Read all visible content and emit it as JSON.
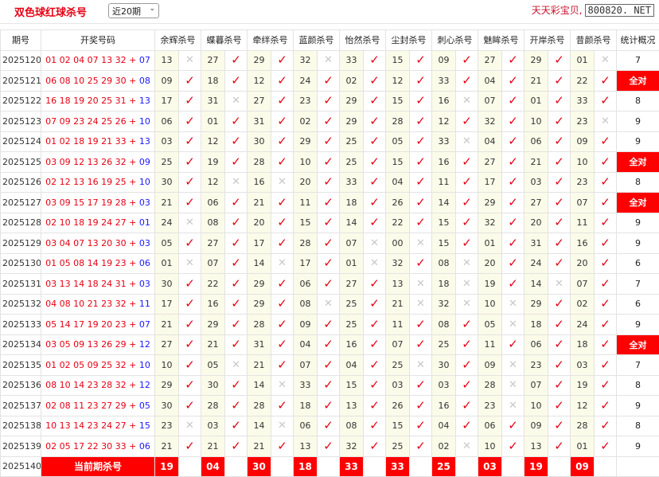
{
  "header": {
    "title": "双色球红球杀号",
    "period_select": "近20期",
    "brand_text": "天天彩宝贝,",
    "site": "800820. NET"
  },
  "columns": {
    "issue": "期号",
    "draw": "开奖号码",
    "experts": [
      "余辉杀号",
      "蝶暮杀号",
      "牵绊杀号",
      "蓝颜杀号",
      "怡然杀号",
      "尘封杀号",
      "刺心杀号",
      "魅眸杀号",
      "开岸杀号",
      "昔颜杀号"
    ],
    "stat": "统计概况"
  },
  "rows": [
    {
      "issue": "2025120",
      "red": "01 02 04 07 13 32",
      "blue": "07",
      "kills": [
        {
          "n": "13",
          "ok": false
        },
        {
          "n": "27",
          "ok": true
        },
        {
          "n": "29",
          "ok": true
        },
        {
          "n": "32",
          "ok": false
        },
        {
          "n": "33",
          "ok": true
        },
        {
          "n": "15",
          "ok": true
        },
        {
          "n": "09",
          "ok": true
        },
        {
          "n": "27",
          "ok": true
        },
        {
          "n": "29",
          "ok": true
        },
        {
          "n": "01",
          "ok": false
        }
      ],
      "stat": "7"
    },
    {
      "issue": "2025121",
      "red": "06 08 10 25 29 30",
      "blue": "08",
      "kills": [
        {
          "n": "09",
          "ok": true
        },
        {
          "n": "18",
          "ok": true
        },
        {
          "n": "12",
          "ok": true
        },
        {
          "n": "24",
          "ok": true
        },
        {
          "n": "02",
          "ok": true
        },
        {
          "n": "12",
          "ok": true
        },
        {
          "n": "33",
          "ok": true
        },
        {
          "n": "04",
          "ok": true
        },
        {
          "n": "21",
          "ok": true
        },
        {
          "n": "22",
          "ok": true
        }
      ],
      "stat": "全对"
    },
    {
      "issue": "2025122",
      "red": "16 18 19 20 25 31",
      "blue": "13",
      "kills": [
        {
          "n": "17",
          "ok": true
        },
        {
          "n": "31",
          "ok": false
        },
        {
          "n": "27",
          "ok": true
        },
        {
          "n": "23",
          "ok": true
        },
        {
          "n": "29",
          "ok": true
        },
        {
          "n": "15",
          "ok": true
        },
        {
          "n": "16",
          "ok": false
        },
        {
          "n": "07",
          "ok": true
        },
        {
          "n": "01",
          "ok": true
        },
        {
          "n": "33",
          "ok": true
        }
      ],
      "stat": "8"
    },
    {
      "issue": "2025123",
      "red": "07 09 23 24 25 26",
      "blue": "10",
      "kills": [
        {
          "n": "06",
          "ok": true
        },
        {
          "n": "01",
          "ok": true
        },
        {
          "n": "31",
          "ok": true
        },
        {
          "n": "02",
          "ok": true
        },
        {
          "n": "29",
          "ok": true
        },
        {
          "n": "28",
          "ok": true
        },
        {
          "n": "12",
          "ok": true
        },
        {
          "n": "32",
          "ok": true
        },
        {
          "n": "10",
          "ok": true
        },
        {
          "n": "23",
          "ok": false
        }
      ],
      "stat": "9"
    },
    {
      "issue": "2025124",
      "red": "01 02 18 19 21 33",
      "blue": "13",
      "kills": [
        {
          "n": "03",
          "ok": true
        },
        {
          "n": "12",
          "ok": true
        },
        {
          "n": "30",
          "ok": true
        },
        {
          "n": "29",
          "ok": true
        },
        {
          "n": "25",
          "ok": true
        },
        {
          "n": "05",
          "ok": true
        },
        {
          "n": "33",
          "ok": false
        },
        {
          "n": "04",
          "ok": true
        },
        {
          "n": "06",
          "ok": true
        },
        {
          "n": "09",
          "ok": true
        }
      ],
      "stat": "9"
    },
    {
      "issue": "2025125",
      "red": "03 09 12 13 26 32",
      "blue": "09",
      "kills": [
        {
          "n": "25",
          "ok": true
        },
        {
          "n": "19",
          "ok": true
        },
        {
          "n": "28",
          "ok": true
        },
        {
          "n": "10",
          "ok": true
        },
        {
          "n": "25",
          "ok": true
        },
        {
          "n": "15",
          "ok": true
        },
        {
          "n": "16",
          "ok": true
        },
        {
          "n": "27",
          "ok": true
        },
        {
          "n": "21",
          "ok": true
        },
        {
          "n": "10",
          "ok": true
        }
      ],
      "stat": "全对"
    },
    {
      "issue": "2025126",
      "red": "02 12 13 16 19 25",
      "blue": "10",
      "kills": [
        {
          "n": "30",
          "ok": true
        },
        {
          "n": "12",
          "ok": false
        },
        {
          "n": "16",
          "ok": false
        },
        {
          "n": "20",
          "ok": true
        },
        {
          "n": "33",
          "ok": true
        },
        {
          "n": "04",
          "ok": true
        },
        {
          "n": "11",
          "ok": true
        },
        {
          "n": "17",
          "ok": true
        },
        {
          "n": "03",
          "ok": true
        },
        {
          "n": "23",
          "ok": true
        }
      ],
      "stat": "8"
    },
    {
      "issue": "2025127",
      "red": "03 09 15 17 19 28",
      "blue": "03",
      "kills": [
        {
          "n": "21",
          "ok": true
        },
        {
          "n": "06",
          "ok": true
        },
        {
          "n": "21",
          "ok": true
        },
        {
          "n": "11",
          "ok": true
        },
        {
          "n": "18",
          "ok": true
        },
        {
          "n": "26",
          "ok": true
        },
        {
          "n": "14",
          "ok": true
        },
        {
          "n": "29",
          "ok": true
        },
        {
          "n": "27",
          "ok": true
        },
        {
          "n": "07",
          "ok": true
        }
      ],
      "stat": "全对"
    },
    {
      "issue": "2025128",
      "red": "02 10 18 19 24 27",
      "blue": "01",
      "kills": [
        {
          "n": "24",
          "ok": false
        },
        {
          "n": "08",
          "ok": true
        },
        {
          "n": "20",
          "ok": true
        },
        {
          "n": "15",
          "ok": true
        },
        {
          "n": "14",
          "ok": true
        },
        {
          "n": "22",
          "ok": true
        },
        {
          "n": "15",
          "ok": true
        },
        {
          "n": "32",
          "ok": true
        },
        {
          "n": "20",
          "ok": true
        },
        {
          "n": "11",
          "ok": true
        }
      ],
      "stat": "9"
    },
    {
      "issue": "2025129",
      "red": "03 04 07 13 20 30",
      "blue": "03",
      "kills": [
        {
          "n": "05",
          "ok": true
        },
        {
          "n": "27",
          "ok": true
        },
        {
          "n": "17",
          "ok": true
        },
        {
          "n": "28",
          "ok": true
        },
        {
          "n": "07",
          "ok": false
        },
        {
          "n": "00",
          "ok": false
        },
        {
          "n": "15",
          "ok": true
        },
        {
          "n": "01",
          "ok": true
        },
        {
          "n": "31",
          "ok": true
        },
        {
          "n": "16",
          "ok": true
        }
      ],
      "stat": "9"
    },
    {
      "issue": "2025130",
      "red": "01 05 08 14 19 23",
      "blue": "06",
      "kills": [
        {
          "n": "01",
          "ok": false
        },
        {
          "n": "07",
          "ok": true
        },
        {
          "n": "14",
          "ok": false
        },
        {
          "n": "17",
          "ok": true
        },
        {
          "n": "01",
          "ok": false
        },
        {
          "n": "32",
          "ok": true
        },
        {
          "n": "08",
          "ok": false
        },
        {
          "n": "20",
          "ok": true
        },
        {
          "n": "24",
          "ok": true
        },
        {
          "n": "20",
          "ok": true
        }
      ],
      "stat": "6"
    },
    {
      "issue": "2025131",
      "red": "03 13 14 18 24 31",
      "blue": "03",
      "kills": [
        {
          "n": "30",
          "ok": true
        },
        {
          "n": "22",
          "ok": true
        },
        {
          "n": "29",
          "ok": true
        },
        {
          "n": "06",
          "ok": true
        },
        {
          "n": "27",
          "ok": true
        },
        {
          "n": "13",
          "ok": false
        },
        {
          "n": "18",
          "ok": false
        },
        {
          "n": "19",
          "ok": true
        },
        {
          "n": "14",
          "ok": false
        },
        {
          "n": "07",
          "ok": true
        }
      ],
      "stat": "7"
    },
    {
      "issue": "2025132",
      "red": "04 08 10 21 23 32",
      "blue": "11",
      "kills": [
        {
          "n": "17",
          "ok": true
        },
        {
          "n": "16",
          "ok": true
        },
        {
          "n": "29",
          "ok": true
        },
        {
          "n": "08",
          "ok": false
        },
        {
          "n": "25",
          "ok": true
        },
        {
          "n": "21",
          "ok": false
        },
        {
          "n": "32",
          "ok": false
        },
        {
          "n": "10",
          "ok": false
        },
        {
          "n": "29",
          "ok": true
        },
        {
          "n": "02",
          "ok": true
        }
      ],
      "stat": "6"
    },
    {
      "issue": "2025133",
      "red": "05 14 17 19 20 23",
      "blue": "07",
      "kills": [
        {
          "n": "21",
          "ok": true
        },
        {
          "n": "29",
          "ok": true
        },
        {
          "n": "28",
          "ok": true
        },
        {
          "n": "09",
          "ok": true
        },
        {
          "n": "25",
          "ok": true
        },
        {
          "n": "11",
          "ok": true
        },
        {
          "n": "08",
          "ok": true
        },
        {
          "n": "05",
          "ok": false
        },
        {
          "n": "18",
          "ok": true
        },
        {
          "n": "24",
          "ok": true
        }
      ],
      "stat": "9"
    },
    {
      "issue": "2025134",
      "red": "03 05 09 13 26 29",
      "blue": "12",
      "kills": [
        {
          "n": "27",
          "ok": true
        },
        {
          "n": "21",
          "ok": true
        },
        {
          "n": "31",
          "ok": true
        },
        {
          "n": "04",
          "ok": true
        },
        {
          "n": "16",
          "ok": true
        },
        {
          "n": "07",
          "ok": true
        },
        {
          "n": "25",
          "ok": true
        },
        {
          "n": "11",
          "ok": true
        },
        {
          "n": "06",
          "ok": true
        },
        {
          "n": "18",
          "ok": true
        }
      ],
      "stat": "全对"
    },
    {
      "issue": "2025135",
      "red": "01 02 05 09 25 32",
      "blue": "10",
      "kills": [
        {
          "n": "10",
          "ok": true
        },
        {
          "n": "05",
          "ok": false
        },
        {
          "n": "21",
          "ok": true
        },
        {
          "n": "07",
          "ok": true
        },
        {
          "n": "04",
          "ok": true
        },
        {
          "n": "25",
          "ok": false
        },
        {
          "n": "30",
          "ok": true
        },
        {
          "n": "09",
          "ok": false
        },
        {
          "n": "23",
          "ok": true
        },
        {
          "n": "03",
          "ok": true
        }
      ],
      "stat": "7"
    },
    {
      "issue": "2025136",
      "red": "08 10 14 23 28 32",
      "blue": "12",
      "kills": [
        {
          "n": "29",
          "ok": true
        },
        {
          "n": "30",
          "ok": true
        },
        {
          "n": "14",
          "ok": false
        },
        {
          "n": "33",
          "ok": true
        },
        {
          "n": "15",
          "ok": true
        },
        {
          "n": "03",
          "ok": true
        },
        {
          "n": "03",
          "ok": true
        },
        {
          "n": "28",
          "ok": false
        },
        {
          "n": "07",
          "ok": true
        },
        {
          "n": "19",
          "ok": true
        }
      ],
      "stat": "8"
    },
    {
      "issue": "2025137",
      "red": "02 08 11 23 27 29",
      "blue": "05",
      "kills": [
        {
          "n": "30",
          "ok": true
        },
        {
          "n": "28",
          "ok": true
        },
        {
          "n": "28",
          "ok": true
        },
        {
          "n": "18",
          "ok": true
        },
        {
          "n": "13",
          "ok": true
        },
        {
          "n": "26",
          "ok": true
        },
        {
          "n": "16",
          "ok": true
        },
        {
          "n": "23",
          "ok": false
        },
        {
          "n": "10",
          "ok": true
        },
        {
          "n": "12",
          "ok": true
        }
      ],
      "stat": "9"
    },
    {
      "issue": "2025138",
      "red": "10 13 14 23 24 27",
      "blue": "15",
      "kills": [
        {
          "n": "23",
          "ok": false
        },
        {
          "n": "03",
          "ok": true
        },
        {
          "n": "14",
          "ok": false
        },
        {
          "n": "06",
          "ok": true
        },
        {
          "n": "08",
          "ok": true
        },
        {
          "n": "15",
          "ok": true
        },
        {
          "n": "04",
          "ok": true
        },
        {
          "n": "06",
          "ok": true
        },
        {
          "n": "09",
          "ok": true
        },
        {
          "n": "28",
          "ok": true
        }
      ],
      "stat": "8"
    },
    {
      "issue": "2025139",
      "red": "02 05 17 22 30 33",
      "blue": "06",
      "kills": [
        {
          "n": "21",
          "ok": true
        },
        {
          "n": "21",
          "ok": true
        },
        {
          "n": "21",
          "ok": true
        },
        {
          "n": "13",
          "ok": true
        },
        {
          "n": "32",
          "ok": true
        },
        {
          "n": "25",
          "ok": true
        },
        {
          "n": "02",
          "ok": false
        },
        {
          "n": "10",
          "ok": true
        },
        {
          "n": "13",
          "ok": true
        },
        {
          "n": "01",
          "ok": true
        }
      ],
      "stat": "9"
    }
  ],
  "current": {
    "issue": "2025140",
    "label": "当前期杀号",
    "kills": [
      "19",
      "04",
      "30",
      "18",
      "33",
      "33",
      "25",
      "03",
      "19",
      "09"
    ]
  },
  "glyphs": {
    "ok": "✓",
    "bad": "✕"
  },
  "colors": {
    "accent": "#e60012",
    "blue": "#1a1aff",
    "kill_bg": "#fbfbe9",
    "all_bg": "#ff0000"
  }
}
